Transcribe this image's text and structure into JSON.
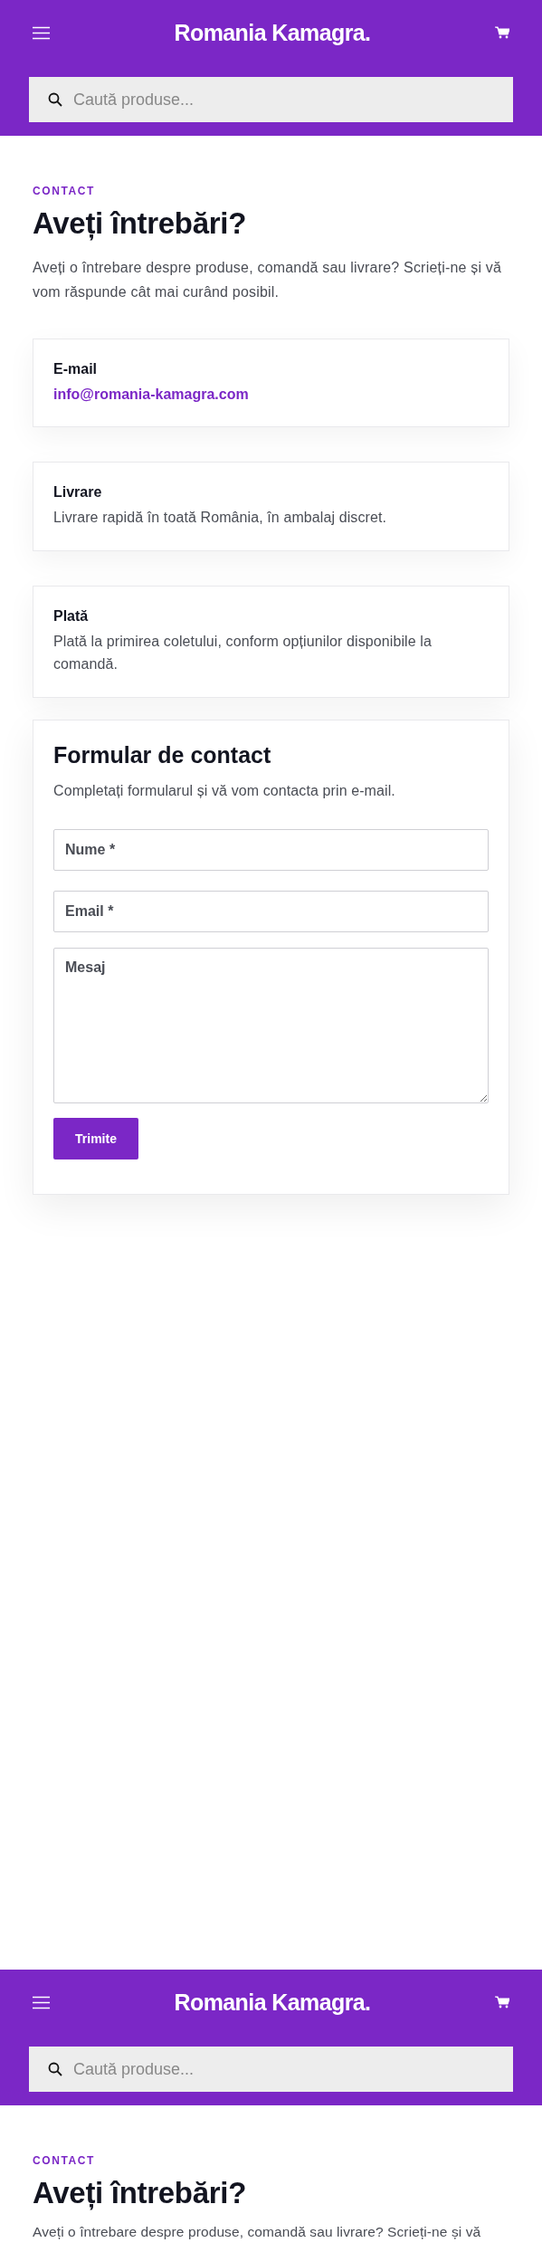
{
  "header": {
    "title": "Romania Kamagra.",
    "search": {
      "placeholder": "Caută produse..."
    }
  },
  "intro": {
    "eyebrow": "CONTACT",
    "heading": "Aveți întrebări?",
    "text": "Aveți o întrebare despre produse, comandă sau livrare? Scrieți-ne și vă vom răspunde cât mai curând posibil."
  },
  "info_cards": [
    {
      "kind": "link",
      "title": "E-mail",
      "text": "info@romania-kamagra.com"
    },
    {
      "kind": "text",
      "title": "Livrare",
      "text": "Livrare rapidă în toată România, în ambalaj discret."
    },
    {
      "kind": "text",
      "title": "Plată",
      "text": "Plată la primirea coletului, conform opțiunilor disponibile la comandă."
    }
  ],
  "contact_form": {
    "title": "Formular de contact",
    "subtitle": "Completați formularul și vă vom contacta prin e-mail.",
    "fields": [
      {
        "kind": "input",
        "placeholder": "Nume *"
      },
      {
        "kind": "input",
        "placeholder": "Email *"
      },
      {
        "kind": "textarea",
        "placeholder": "Mesaj"
      }
    ],
    "submit": "Trimite"
  },
  "repeated_view": {
    "header": {
      "title": "Romania Kamagra.",
      "search": {
        "placeholder": "Caută produse..."
      }
    },
    "intro": {
      "eyebrow": "CONTACT",
      "heading": "Aveți întrebări?",
      "text": "Aveți o întrebare despre produse, comandă sau livrare? Scrieți-ne și vă"
    }
  }
}
